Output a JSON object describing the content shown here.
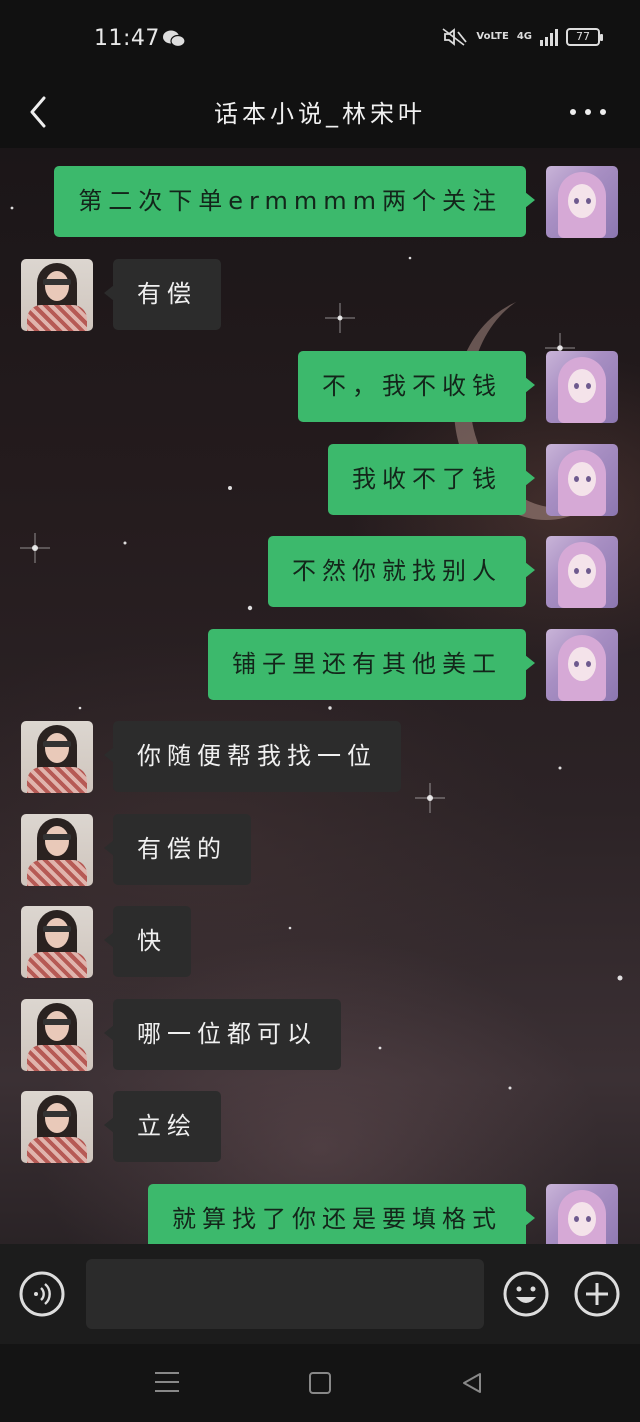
{
  "status_bar": {
    "time": "11:47",
    "volte_label": "VoLTE",
    "network_label": "4G",
    "battery": "77"
  },
  "header": {
    "title": "话本小说_林宋叶"
  },
  "messages": [
    {
      "side": "me",
      "text": "第二次下单ermmmm两个关注"
    },
    {
      "side": "other",
      "text": "有偿"
    },
    {
      "side": "me",
      "text": "不，我不收钱"
    },
    {
      "side": "me",
      "text": "我收不了钱"
    },
    {
      "side": "me",
      "text": "不然你就找别人"
    },
    {
      "side": "me",
      "text": "铺子里还有其他美工"
    },
    {
      "side": "other",
      "text": "你随便帮我找一位"
    },
    {
      "side": "other",
      "text": "有偿的"
    },
    {
      "side": "other",
      "text": "快"
    },
    {
      "side": "other",
      "text": "哪一位都可以"
    },
    {
      "side": "other",
      "text": "立绘"
    },
    {
      "side": "me",
      "text": "就算找了你还是要填格式"
    }
  ],
  "input": {
    "value": ""
  },
  "colors": {
    "my_bubble": "#3cb96c",
    "other_bubble": "#2c2c2c",
    "bar_background": "#111111"
  }
}
